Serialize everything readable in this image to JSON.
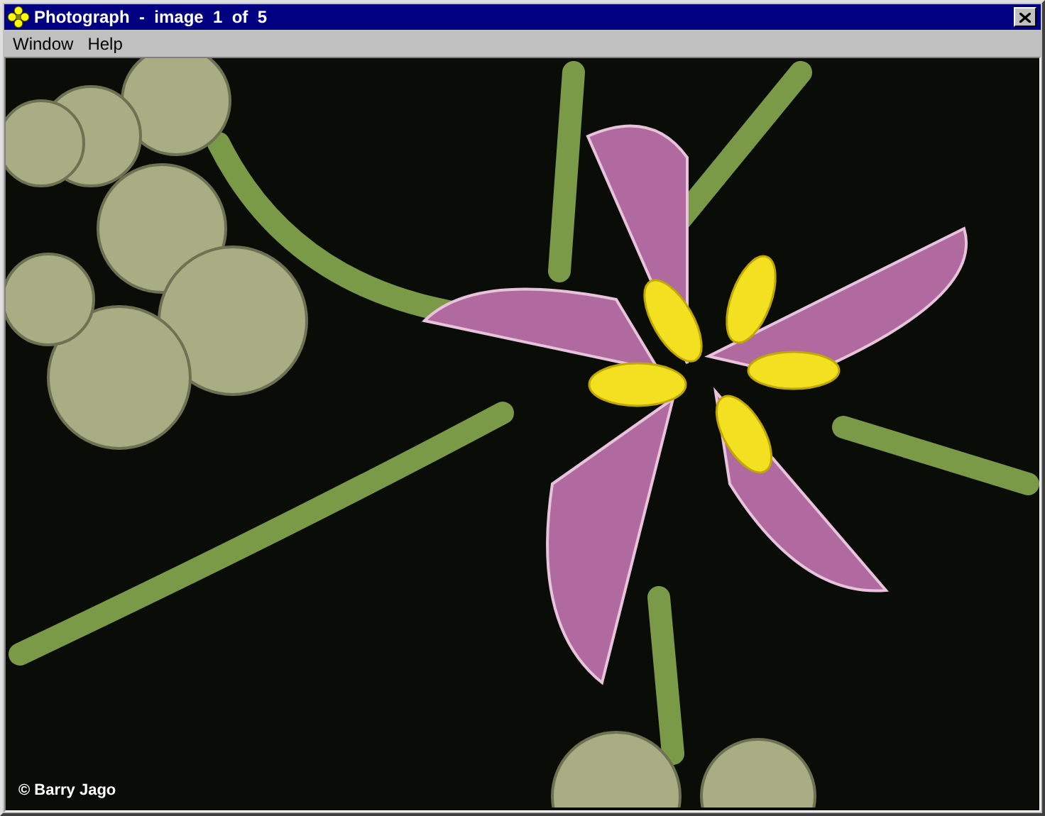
{
  "window": {
    "title": "Photograph  -  image  1  of  5"
  },
  "menu": [
    "Window",
    "Help"
  ],
  "photo": {
    "credit": "© Barry Jago"
  }
}
